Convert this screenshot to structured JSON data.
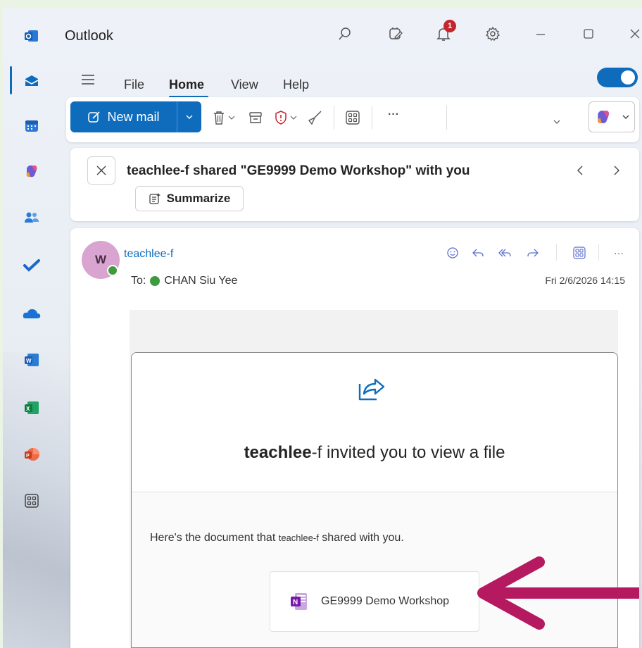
{
  "app": {
    "title": "Outlook",
    "notification_count": "1"
  },
  "menu": {
    "items": [
      "File",
      "Home",
      "View",
      "Help"
    ],
    "active": "Home"
  },
  "ribbon": {
    "new_mail_label": "New mail",
    "more_label": "···"
  },
  "message": {
    "subject": "teachlee-f shared \"GE9999 Demo Workshop\" with you",
    "summarize_label": "Summarize",
    "sender_name": "teachlee-f",
    "avatar_initial": "W",
    "to_prefix": "To:",
    "to_name": "CHAN Siu Yee",
    "date": "Fri 2/6/2026 14:15",
    "more_label": "···"
  },
  "card": {
    "invite_sender": "teachlee",
    "invite_rest": "-f invited you to view a file",
    "doc_text_start": "Here's the document that ",
    "doc_text_sender": "teachlee-f",
    "doc_text_end": " shared with you.",
    "file_name": "GE9999 Demo Workshop"
  },
  "colors": {
    "accent": "#0f6cbd",
    "arrow": "#b5195f",
    "presence": "#3e9b3e",
    "badge": "#c4262e"
  }
}
